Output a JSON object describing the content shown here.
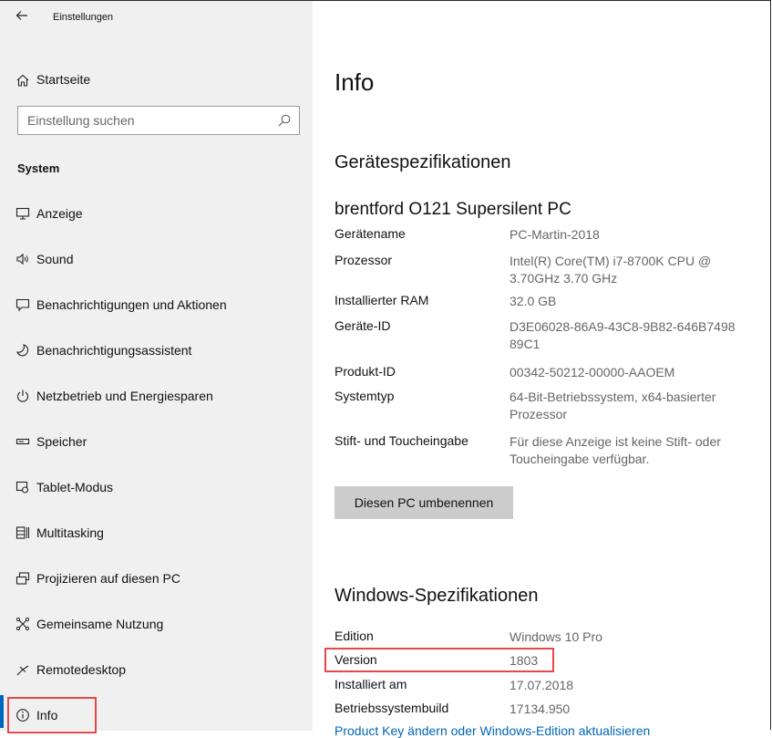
{
  "window": {
    "title": "Einstellungen"
  },
  "sidebar": {
    "home_label": "Startseite",
    "search_placeholder": "Einstellung suchen",
    "section": "System",
    "items": [
      {
        "label": "Anzeige",
        "icon": "monitor-icon"
      },
      {
        "label": "Sound",
        "icon": "speaker-icon"
      },
      {
        "label": "Benachrichtigungen und Aktionen",
        "icon": "notification-icon"
      },
      {
        "label": "Benachrichtigungsassistent",
        "icon": "moon-icon"
      },
      {
        "label": "Netzbetrieb und Energiesparen",
        "icon": "power-icon"
      },
      {
        "label": "Speicher",
        "icon": "storage-icon"
      },
      {
        "label": "Tablet-Modus",
        "icon": "tablet-mode-icon"
      },
      {
        "label": "Multitasking",
        "icon": "multitasking-icon"
      },
      {
        "label": "Projizieren auf diesen PC",
        "icon": "project-icon"
      },
      {
        "label": "Gemeinsame Nutzung",
        "icon": "shared-experiences-icon"
      },
      {
        "label": "Remotedesktop",
        "icon": "remote-desktop-icon"
      },
      {
        "label": "Info",
        "icon": "info-icon",
        "selected": true
      }
    ],
    "accent_color": "#0067c0"
  },
  "main": {
    "title": "Info",
    "device_specs_heading": "Gerätespezifikationen",
    "device_model": "brentford O121 Supersilent PC",
    "device_specs": [
      {
        "key": "Gerätename",
        "value": "PC-Martin-2018"
      },
      {
        "key": "Prozessor",
        "value": "Intel(R) Core(TM) i7-8700K CPU @ 3.70GHz   3.70 GHz"
      },
      {
        "key": "Installierter RAM",
        "value": "32.0 GB"
      },
      {
        "key": "Geräte-ID",
        "value": "D3E06028-86A9-43C8-9B82-646B7498 89C1"
      },
      {
        "key": "Produkt-ID",
        "value": "00342-50212-00000-AAOEM"
      },
      {
        "key": "Systemtyp",
        "value": "64-Bit-Betriebssystem, x64-basierter Prozessor"
      },
      {
        "key": "Stift- und Toucheingabe",
        "value": "Für diese Anzeige ist keine Stift- oder Toucheingabe verfügbar."
      }
    ],
    "rename_button": "Diesen PC umbenennen",
    "windows_specs_heading": "Windows-Spezifikationen",
    "windows_specs": [
      {
        "key": "Edition",
        "value": "Windows 10 Pro"
      },
      {
        "key": "Version",
        "value": "1803"
      },
      {
        "key": "Installiert am",
        "value": "17.07.2018"
      },
      {
        "key": "Betriebssystembuild",
        "value": "17134.950"
      }
    ],
    "bottom_link": "Product Key ändern oder Windows-Edition aktualisieren"
  },
  "highlight_color": "#e6474a"
}
